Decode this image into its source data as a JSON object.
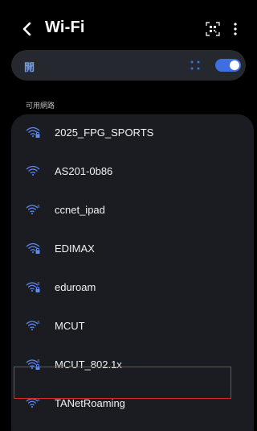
{
  "header": {
    "title": "Wi-Fi",
    "back_icon": "chevron-left-icon",
    "qr_icon": "qr-scan-icon",
    "more_icon": "more-vertical-icon"
  },
  "toggle": {
    "label": "開",
    "state": "on",
    "accent_color": "#3d6fe0"
  },
  "section": {
    "available_networks_label": "可用網路"
  },
  "networks": [
    {
      "ssid": "2025_FPG_SPORTS",
      "icon": "wifi-locked-icon"
    },
    {
      "ssid": "AS201-0b86",
      "icon": "wifi-icon"
    },
    {
      "ssid": "ccnet_ipad",
      "icon": "wifi-6-icon"
    },
    {
      "ssid": "EDIMAX",
      "icon": "wifi-locked-icon"
    },
    {
      "ssid": "eduroam",
      "icon": "wifi-6-locked-icon"
    },
    {
      "ssid": "MCUT",
      "icon": "wifi-6-icon"
    },
    {
      "ssid": "MCUT_802.1x",
      "icon": "wifi-6-locked-icon",
      "highlighted": true
    },
    {
      "ssid": "TANetRoaming",
      "icon": "wifi-6-icon"
    }
  ]
}
